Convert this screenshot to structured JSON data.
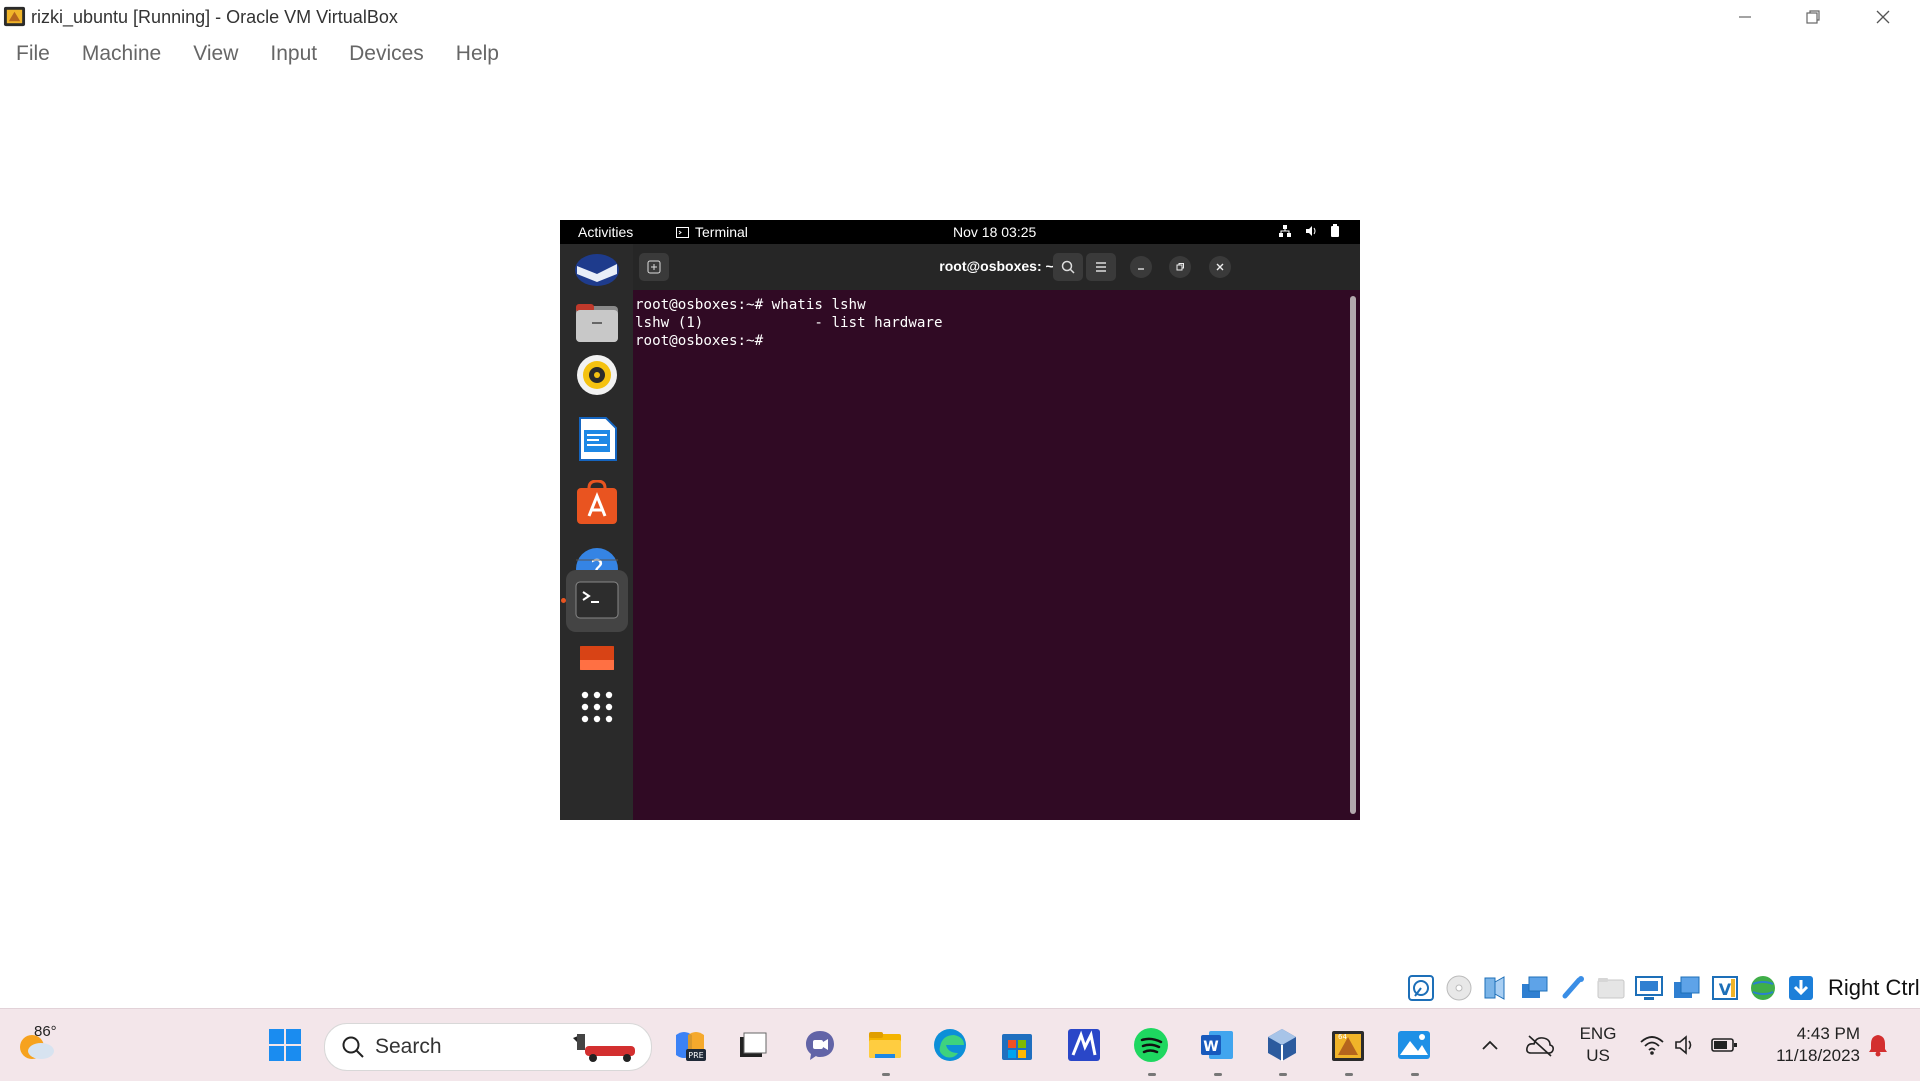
{
  "window": {
    "title": "rizki_ubuntu [Running] - Oracle VM VirtualBox"
  },
  "menu": [
    "File",
    "Machine",
    "View",
    "Input",
    "Devices",
    "Help"
  ],
  "gnome": {
    "activities": "Activities",
    "app_label": "Terminal",
    "clock": "Nov 18  03:25"
  },
  "terminal": {
    "title": "root@osboxes: ~",
    "lines": [
      "root@osboxes:~# whatis lshw",
      "lshw (1)             - list hardware",
      "root@osboxes:~#"
    ]
  },
  "vbox_status": {
    "host_key": "Right Ctrl"
  },
  "taskbar": {
    "weather_temp": "86°",
    "search_label": "Search",
    "lang_top": "ENG",
    "lang_bottom": "US",
    "time": "4:43 PM",
    "date": "11/18/2023"
  },
  "colors": {
    "terminal_bg": "#300a24",
    "dock_bg": "#2a2a2a",
    "taskbar_bg": "#f3e6ea"
  }
}
